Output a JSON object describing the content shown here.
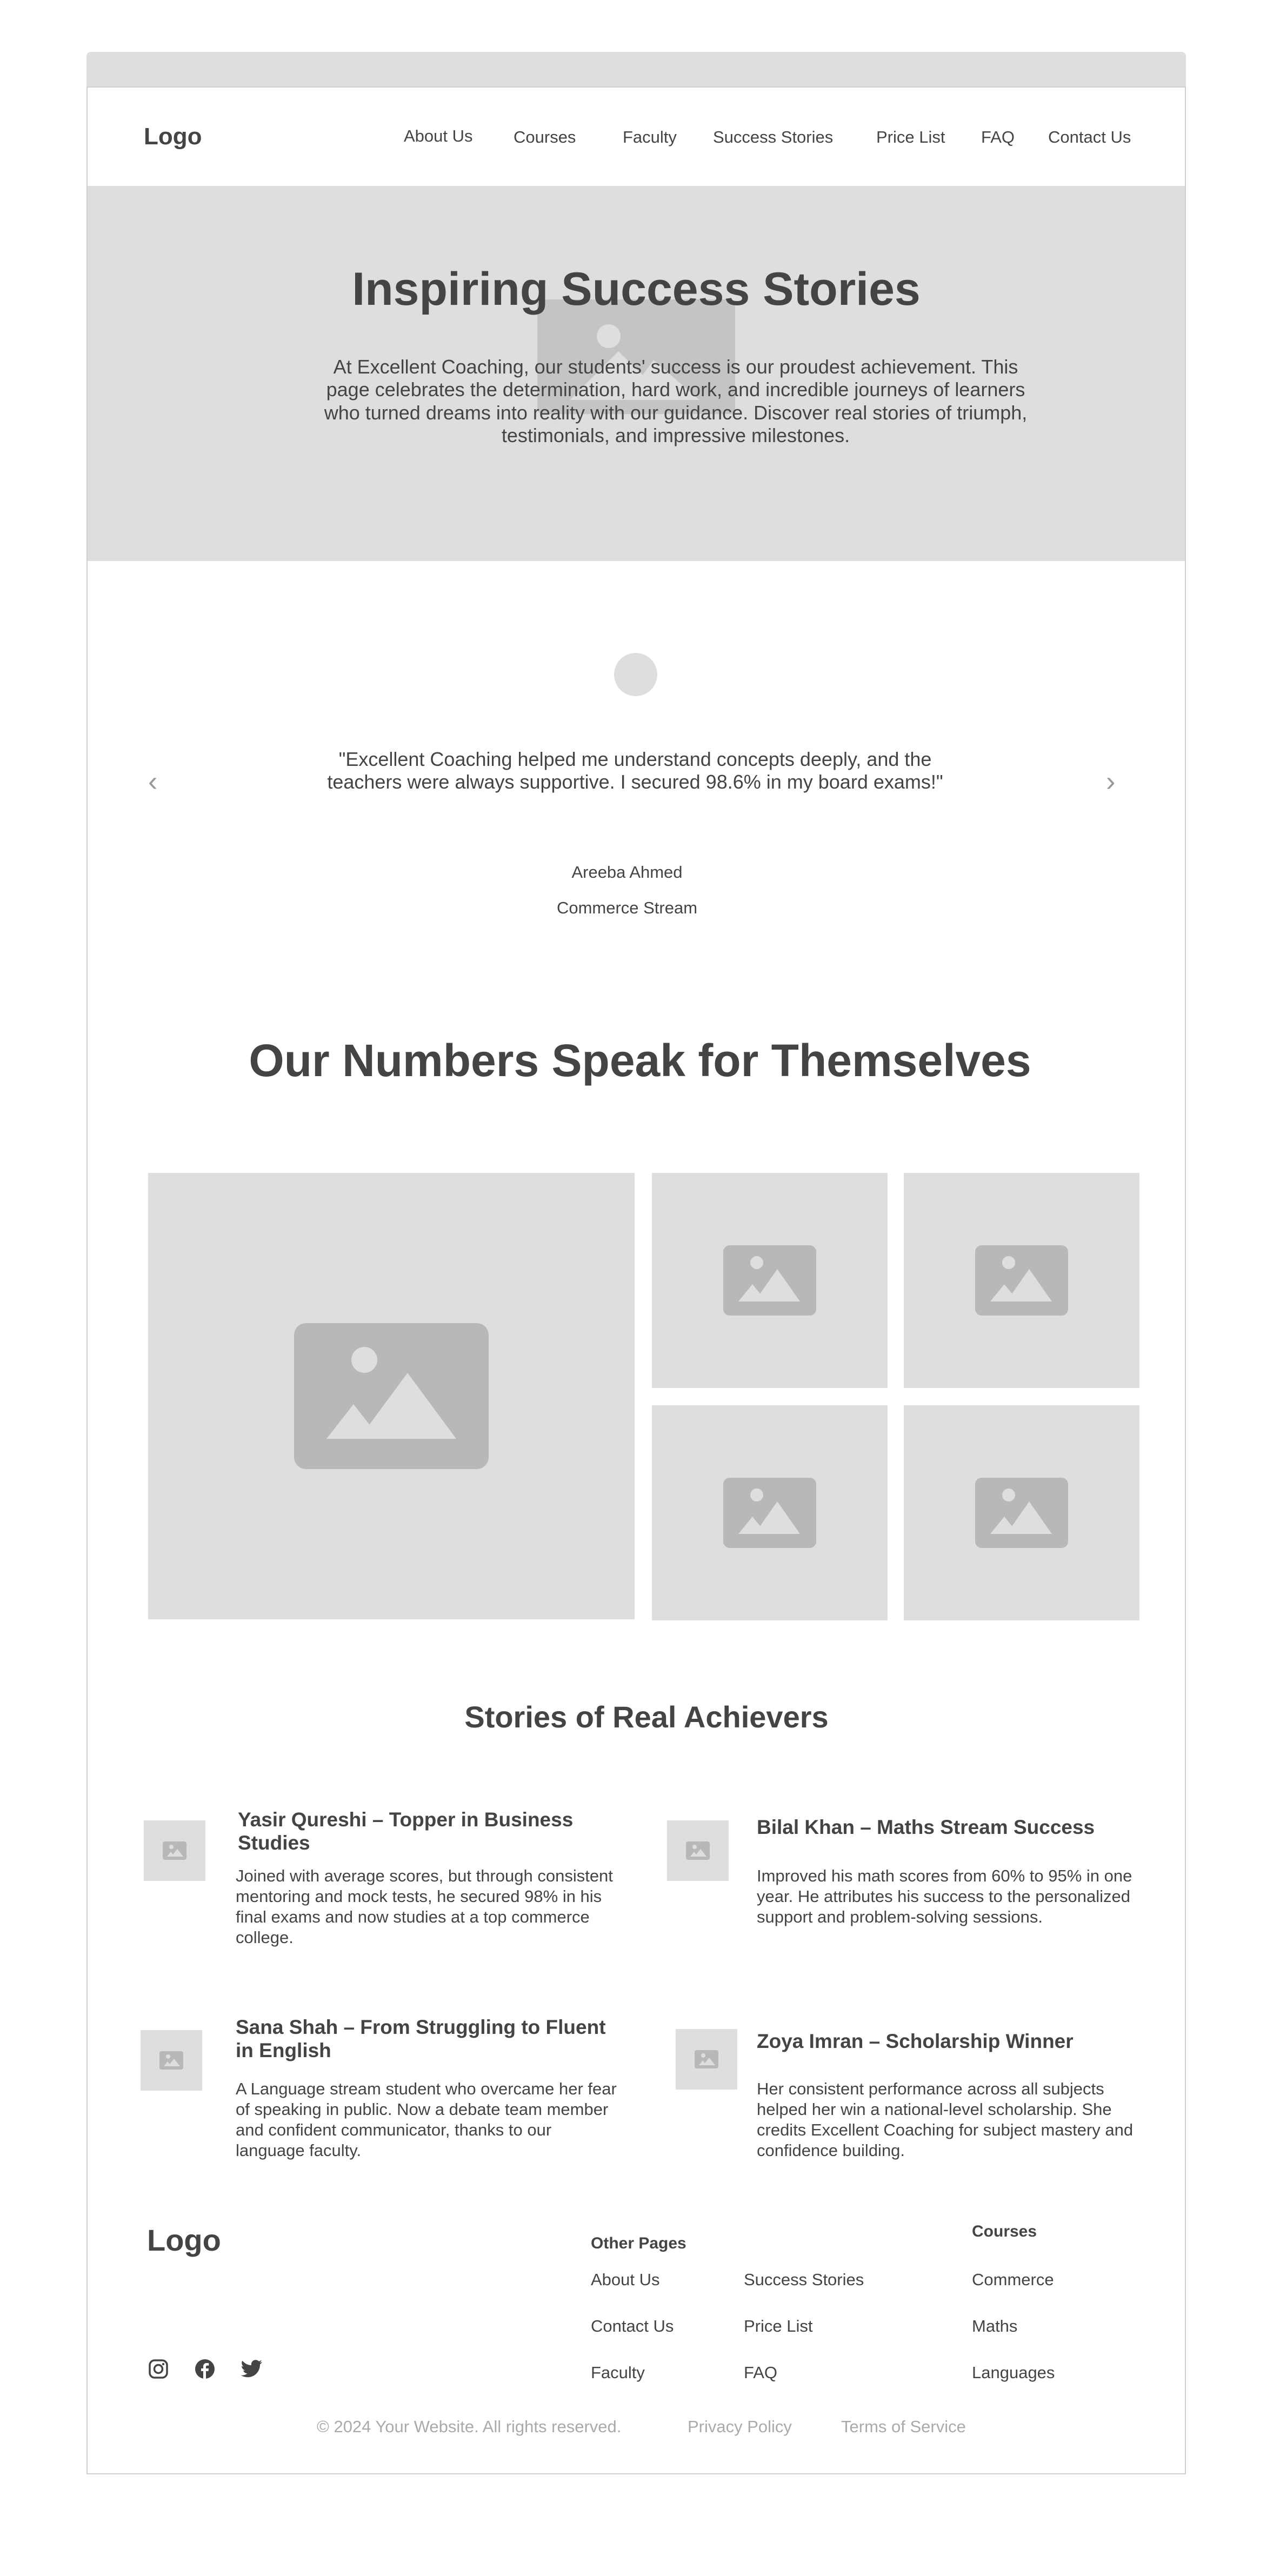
{
  "header": {
    "logo": "Logo",
    "nav": [
      "About Us",
      "Courses",
      "Faculty",
      "Success Stories",
      "Price List",
      "FAQ",
      "Contact Us"
    ]
  },
  "hero": {
    "title": "Inspiring Success Stories",
    "description": "At Excellent Coaching, our students' success is our proudest achievement. This page celebrates the determination, hard work, and incredible journeys of learners who turned dreams into reality with our guidance. Discover real stories of triumph, testimonials, and impressive milestones.",
    "background_icon": "image-placeholder-icon"
  },
  "testimonial": {
    "quote": "\"Excellent Coaching helped me understand concepts deeply, and the teachers were always supportive. I secured 98.6% in my board exams!\"",
    "name": "Areeba Ahmed",
    "stream": "Commerce Stream",
    "prev_icon": "chevron-left-icon",
    "next_icon": "chevron-right-icon"
  },
  "numbers": {
    "title": "Our Numbers Speak for Themselves"
  },
  "achievers": {
    "title": "Stories of Real Achievers",
    "stories": [
      {
        "title": "Yasir Qureshi – Topper in Business Studies",
        "text": "Joined with average scores, but through consistent mentoring and mock tests, he secured 98% in his final exams and now studies at a top commerce college."
      },
      {
        "title": "Bilal Khan – Maths Stream Success",
        "text": "Improved his math scores from 60% to 95% in one year. He attributes his success to the personalized support and problem-solving sessions."
      },
      {
        "title": "Sana Shah – From Struggling to Fluent in English",
        "text": "A Language stream student who overcame her fear of speaking in public. Now a debate team member and confident communicator, thanks to our language faculty."
      },
      {
        "title": "Zoya Imran – Scholarship Winner",
        "text": "Her consistent performance across all subjects helped her win a national-level scholarship. She credits Excellent Coaching for subject mastery and confidence building."
      }
    ]
  },
  "footer": {
    "logo": "Logo",
    "other_pages_heading": "Other Pages",
    "other_pages_col1": [
      "About Us",
      "Contact Us",
      "Faculty"
    ],
    "other_pages_col2": [
      "Success Stories",
      "Price List",
      "FAQ"
    ],
    "courses_heading": "Courses",
    "courses": [
      "Commerce",
      "Maths",
      "Languages"
    ],
    "social_icons": [
      "instagram-icon",
      "facebook-icon",
      "twitter-icon"
    ],
    "copyright": "© 2024 Your Website. All rights reserved.",
    "privacy": "Privacy Policy",
    "terms": "Terms of Service"
  },
  "colors": {
    "placeholder_bg": "#dedede",
    "placeholder_icon": "#b8b8b8",
    "text": "#444444",
    "muted": "#aaaaaa"
  }
}
